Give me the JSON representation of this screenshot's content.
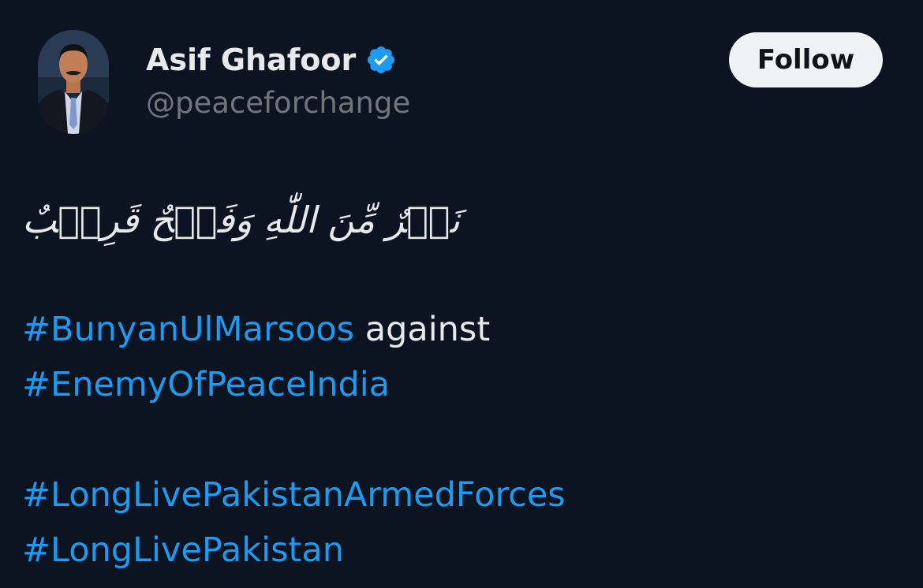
{
  "author": {
    "display_name": "Asif Ghafoor",
    "handle": "@peaceforchange",
    "verified": true
  },
  "actions": {
    "follow_label": "Follow"
  },
  "tweet": {
    "arabic_text": "نَصۡرٌ مِّنَ اللّٰهِ وَفَتۡحٌ قَرِيۡبٌ",
    "line1": {
      "hashtag": "#BunyanUlMarsoos",
      "text": "against"
    },
    "line2": {
      "hashtag": "#EnemyOfPeaceIndia"
    },
    "line3": {
      "hashtag": "#LongLivePakistanArmedForces"
    },
    "line4": {
      "hashtag": "#LongLivePakistan"
    }
  },
  "colors": {
    "background": "#0b1420",
    "text": "#e7e9ea",
    "muted": "#71767b",
    "link": "#1d9bf0",
    "verified": "#1d9bf0"
  }
}
